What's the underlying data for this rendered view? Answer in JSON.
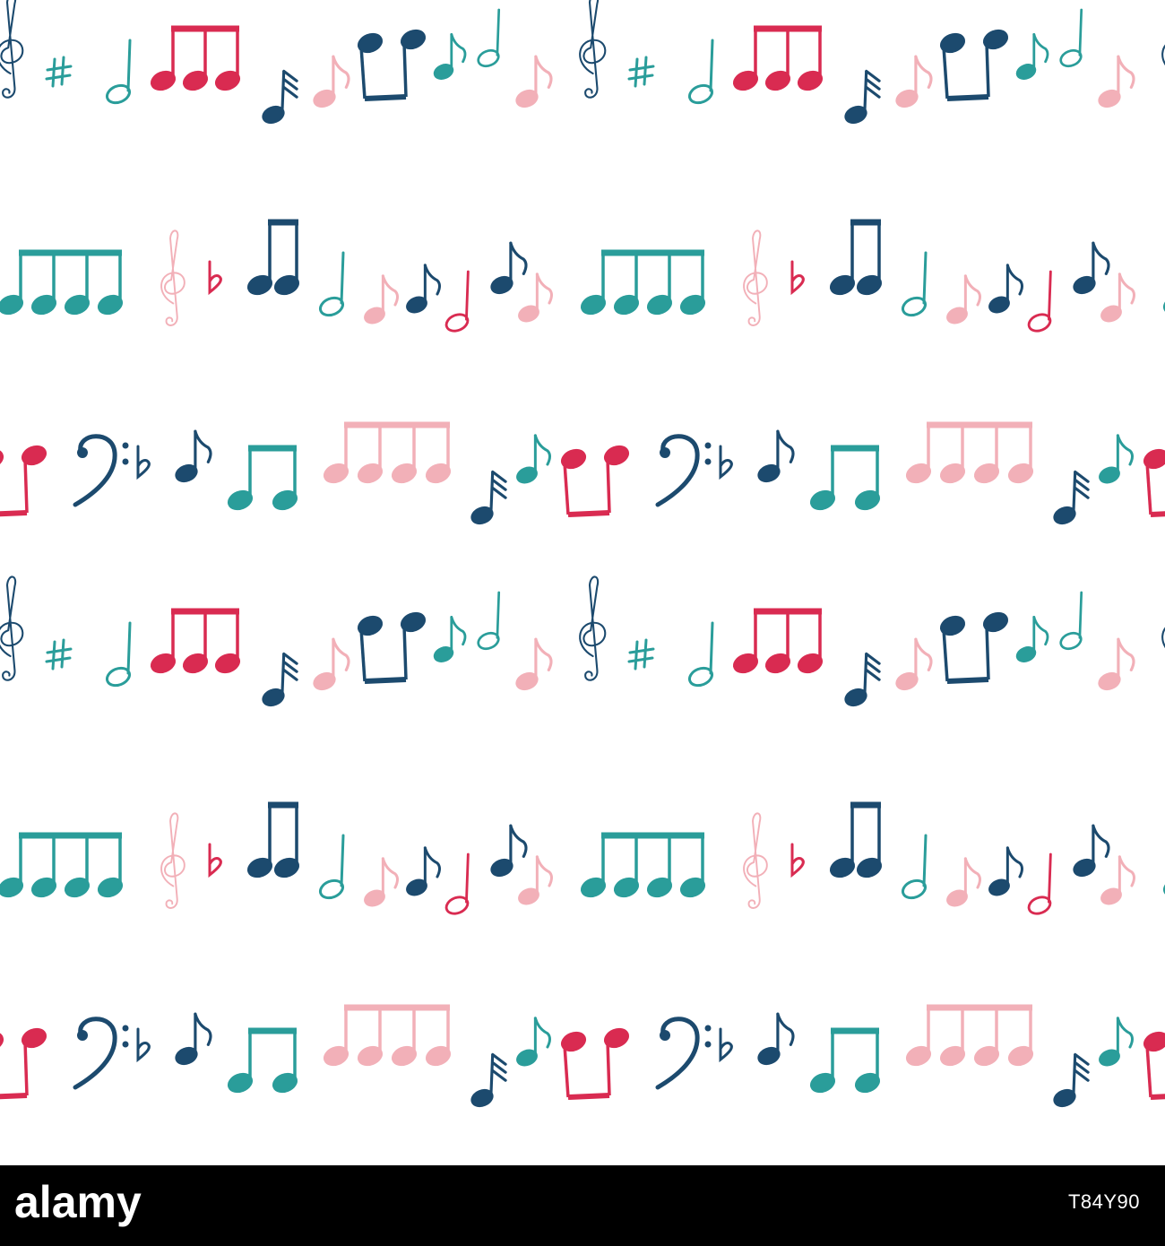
{
  "footer": {
    "logo_text": "alamy",
    "image_id": "T84Y90"
  },
  "colors": {
    "navy": "#1c4a6e",
    "teal": "#2a9d9a",
    "red": "#d92b51",
    "pink": "#f2b0b8",
    "background": "#ffffff",
    "footer": "#000000"
  },
  "pattern": {
    "style": "hand-drawn music notes seamless pattern",
    "symbols": [
      "treble-clef-icon",
      "bass-clef-icon",
      "sharp-icon",
      "flat-icon",
      "eighth-note-icon",
      "half-note-icon",
      "beamed-notes-icon",
      "sixteenth-note-icon"
    ]
  }
}
